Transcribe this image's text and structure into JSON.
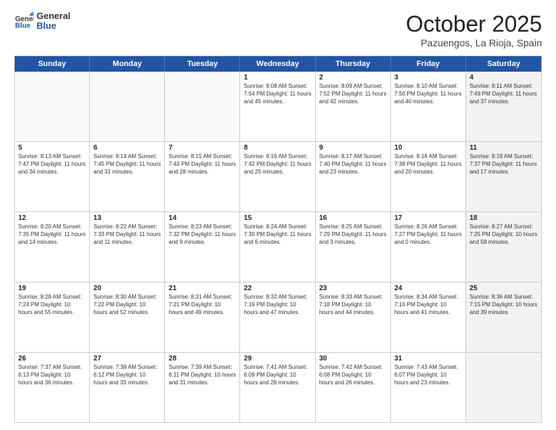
{
  "header": {
    "logo_line1": "General",
    "logo_line2": "Blue",
    "title": "October 2025",
    "subtitle": "Pazuengos, La Rioja, Spain"
  },
  "calendar": {
    "days": [
      "Sunday",
      "Monday",
      "Tuesday",
      "Wednesday",
      "Thursday",
      "Friday",
      "Saturday"
    ],
    "rows": [
      [
        {
          "day": "",
          "info": "",
          "empty": true
        },
        {
          "day": "",
          "info": "",
          "empty": true
        },
        {
          "day": "",
          "info": "",
          "empty": true
        },
        {
          "day": "1",
          "info": "Sunrise: 8:08 AM\nSunset: 7:54 PM\nDaylight: 11 hours\nand 45 minutes."
        },
        {
          "day": "2",
          "info": "Sunrise: 8:09 AM\nSunset: 7:52 PM\nDaylight: 11 hours\nand 42 minutes."
        },
        {
          "day": "3",
          "info": "Sunrise: 8:10 AM\nSunset: 7:50 PM\nDaylight: 11 hours\nand 40 minutes."
        },
        {
          "day": "4",
          "info": "Sunrise: 8:11 AM\nSunset: 7:49 PM\nDaylight: 11 hours\nand 37 minutes.",
          "shaded": true
        }
      ],
      [
        {
          "day": "5",
          "info": "Sunrise: 8:13 AM\nSunset: 7:47 PM\nDaylight: 11 hours\nand 34 minutes."
        },
        {
          "day": "6",
          "info": "Sunrise: 8:14 AM\nSunset: 7:45 PM\nDaylight: 11 hours\nand 31 minutes."
        },
        {
          "day": "7",
          "info": "Sunrise: 8:15 AM\nSunset: 7:43 PM\nDaylight: 11 hours\nand 28 minutes."
        },
        {
          "day": "8",
          "info": "Sunrise: 8:16 AM\nSunset: 7:42 PM\nDaylight: 11 hours\nand 25 minutes."
        },
        {
          "day": "9",
          "info": "Sunrise: 8:17 AM\nSunset: 7:40 PM\nDaylight: 11 hours\nand 23 minutes."
        },
        {
          "day": "10",
          "info": "Sunrise: 8:18 AM\nSunset: 7:38 PM\nDaylight: 11 hours\nand 20 minutes."
        },
        {
          "day": "11",
          "info": "Sunrise: 8:19 AM\nSunset: 7:37 PM\nDaylight: 11 hours\nand 17 minutes.",
          "shaded": true
        }
      ],
      [
        {
          "day": "12",
          "info": "Sunrise: 8:20 AM\nSunset: 7:35 PM\nDaylight: 11 hours\nand 14 minutes."
        },
        {
          "day": "13",
          "info": "Sunrise: 8:22 AM\nSunset: 7:33 PM\nDaylight: 11 hours\nand 11 minutes."
        },
        {
          "day": "14",
          "info": "Sunrise: 8:23 AM\nSunset: 7:32 PM\nDaylight: 11 hours\nand 9 minutes."
        },
        {
          "day": "15",
          "info": "Sunrise: 8:24 AM\nSunset: 7:30 PM\nDaylight: 11 hours\nand 6 minutes."
        },
        {
          "day": "16",
          "info": "Sunrise: 8:25 AM\nSunset: 7:29 PM\nDaylight: 11 hours\nand 3 minutes."
        },
        {
          "day": "17",
          "info": "Sunrise: 8:26 AM\nSunset: 7:27 PM\nDaylight: 11 hours\nand 0 minutes."
        },
        {
          "day": "18",
          "info": "Sunrise: 8:27 AM\nSunset: 7:25 PM\nDaylight: 10 hours\nand 58 minutes.",
          "shaded": true
        }
      ],
      [
        {
          "day": "19",
          "info": "Sunrise: 8:28 AM\nSunset: 7:24 PM\nDaylight: 10 hours\nand 55 minutes."
        },
        {
          "day": "20",
          "info": "Sunrise: 8:30 AM\nSunset: 7:22 PM\nDaylight: 10 hours\nand 52 minutes."
        },
        {
          "day": "21",
          "info": "Sunrise: 8:31 AM\nSunset: 7:21 PM\nDaylight: 10 hours\nand 49 minutes."
        },
        {
          "day": "22",
          "info": "Sunrise: 8:32 AM\nSunset: 7:19 PM\nDaylight: 10 hours\nand 47 minutes."
        },
        {
          "day": "23",
          "info": "Sunrise: 8:33 AM\nSunset: 7:18 PM\nDaylight: 10 hours\nand 44 minutes."
        },
        {
          "day": "24",
          "info": "Sunrise: 8:34 AM\nSunset: 7:16 PM\nDaylight: 10 hours\nand 41 minutes."
        },
        {
          "day": "25",
          "info": "Sunrise: 8:36 AM\nSunset: 7:15 PM\nDaylight: 10 hours\nand 39 minutes.",
          "shaded": true
        }
      ],
      [
        {
          "day": "26",
          "info": "Sunrise: 7:37 AM\nSunset: 6:13 PM\nDaylight: 10 hours\nand 36 minutes."
        },
        {
          "day": "27",
          "info": "Sunrise: 7:38 AM\nSunset: 6:12 PM\nDaylight: 10 hours\nand 33 minutes."
        },
        {
          "day": "28",
          "info": "Sunrise: 7:39 AM\nSunset: 6:11 PM\nDaylight: 10 hours\nand 31 minutes."
        },
        {
          "day": "29",
          "info": "Sunrise: 7:41 AM\nSunset: 6:09 PM\nDaylight: 10 hours\nand 28 minutes."
        },
        {
          "day": "30",
          "info": "Sunrise: 7:42 AM\nSunset: 6:08 PM\nDaylight: 10 hours\nand 26 minutes."
        },
        {
          "day": "31",
          "info": "Sunrise: 7:43 AM\nSunset: 6:07 PM\nDaylight: 10 hours\nand 23 minutes."
        },
        {
          "day": "",
          "info": "",
          "empty": true,
          "shaded": true
        }
      ]
    ]
  }
}
